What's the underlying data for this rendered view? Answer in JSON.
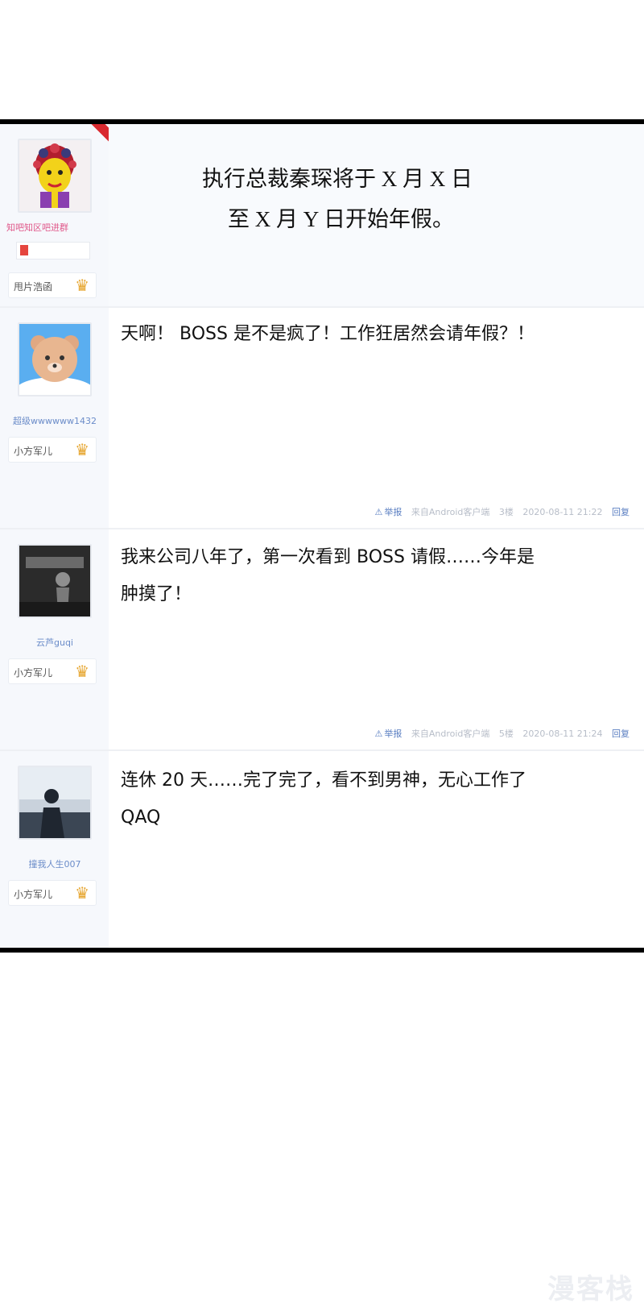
{
  "thread": {
    "op": {
      "username": "知吧知区吧进群",
      "badge_label": "甩片浩函",
      "title_line1": "执行总裁秦琛将于 X 月 X 日",
      "title_line2": "至 X 月 Y 日开始年假。"
    },
    "replies": [
      {
        "username": "超级wwwwww1432",
        "badge_label": "小方军儿",
        "text_line1": "天啊！ BOSS 是不是疯了！工作狂居然会请年假？！",
        "text_line2": "",
        "meta": {
          "report": "举报",
          "source": "来自Android客户端",
          "floor": "3楼",
          "time": "2020-08-11 21:22",
          "reply": "回复"
        }
      },
      {
        "username": "云芦guqi",
        "badge_label": "小方军儿",
        "text_line1": "我来公司八年了，第一次看到 BOSS 请假……今年是",
        "text_line2": "肿摸了！",
        "meta": {
          "report": "举报",
          "source": "来自Android客户端",
          "floor": "5楼",
          "time": "2020-08-11 21:24",
          "reply": "回复"
        }
      },
      {
        "username": "撞我人生007",
        "badge_label": "小方军儿",
        "text_line1": "连休 20 天……完了完了，看不到男神，无心工作了",
        "text_line2": "QAQ"
      }
    ]
  },
  "watermark": "漫客栈",
  "colors": {
    "link": "#5b7fc2",
    "sidebar": "#f6f8fc",
    "badge_star": "#e6a42c",
    "ribbon": "#d9292f"
  },
  "icons": {
    "badge": "crown-icon",
    "report": "warning-triangle-icon"
  }
}
